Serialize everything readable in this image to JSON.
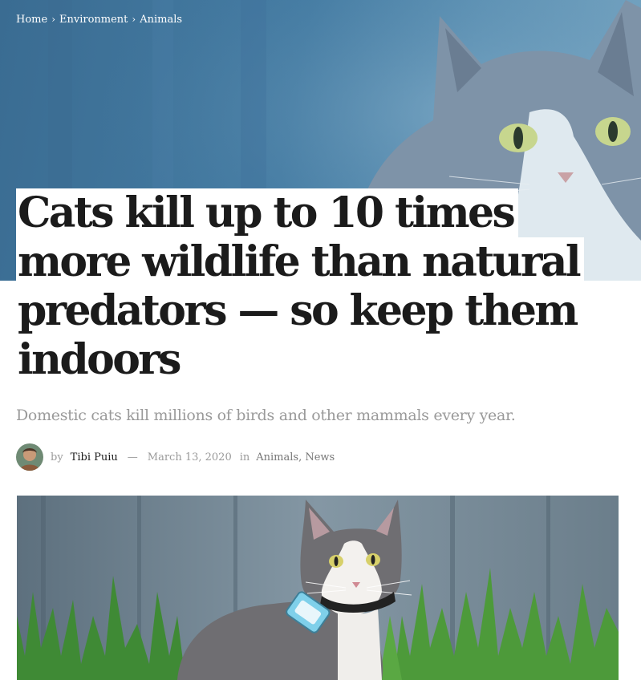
{
  "breadcrumb": {
    "items": [
      "Home",
      "Environment",
      "Animals"
    ],
    "separator": "›"
  },
  "article": {
    "title": "Cats kill up to 10 times more wildlife than natural predators — so keep them indoors",
    "subtitle": "Domestic cats kill millions of birds and other mammals every year.",
    "meta": {
      "by": "by",
      "author": "Tibi Puiu",
      "dash": "—",
      "date": "March 13, 2020",
      "in": "in",
      "categories": [
        "Animals",
        "News"
      ],
      "category_separator": ","
    }
  },
  "images": {
    "hero": "gray-and-white-cat-blue-tint",
    "featured": "cat-with-gps-tracker-collar-in-grass"
  },
  "colors": {
    "hero_tint": "#457ca3",
    "title_text": "#1b1b1b",
    "muted_text": "#9a9a9a",
    "grass": "#4d9a3a",
    "tracker": "#7fd0ea"
  }
}
